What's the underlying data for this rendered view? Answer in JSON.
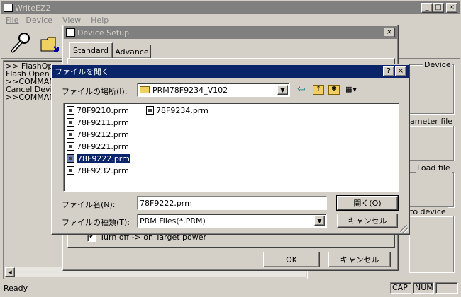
{
  "main_window": {
    "title": "WriteEZ2",
    "menu": [
      "File",
      "Device",
      "View",
      "Help"
    ],
    "console_lines": [
      ">> FlashOpen",
      "Flash Open C",
      ">>COMMANDS",
      "Cancel Devic",
      ">>COMMAND"
    ],
    "right_groups": [
      "Device",
      "ameter file",
      "Load file",
      "to device"
    ],
    "status": {
      "text": "Ready",
      "cap": "CAP",
      "num": "NUM"
    },
    "caption_buttons": {
      "minimize": "_",
      "maximize": "□",
      "close": "×"
    }
  },
  "device_setup": {
    "title": "Device Setup",
    "tabs": [
      "Standard",
      "Advance"
    ],
    "checkbox_label": "Turn off -> on Target power",
    "checkbox_checked": true,
    "ok_label": "OK",
    "cancel_label": "キャンセル"
  },
  "open_dialog": {
    "title": "ファイルを開く",
    "help_btn": "?",
    "close_btn": "×",
    "location_label": "ファイルの場所(I):",
    "location_value": "PRM78F9234_V102",
    "files_col1": [
      "78F9210.prm",
      "78F9211.prm",
      "78F9212.prm",
      "78F9221.prm",
      "78F9222.prm",
      "78F9232.prm"
    ],
    "files_col2": [
      "78F9234.prm"
    ],
    "selected_file": "78F9222.prm",
    "filename_label": "ファイル名(N):",
    "filename_value": "78F9222.prm",
    "filetype_label": "ファイルの種類(T):",
    "filetype_value": "PRM Files(*.PRM)",
    "open_button": "開く(O)",
    "cancel_button": "キャンセル"
  }
}
